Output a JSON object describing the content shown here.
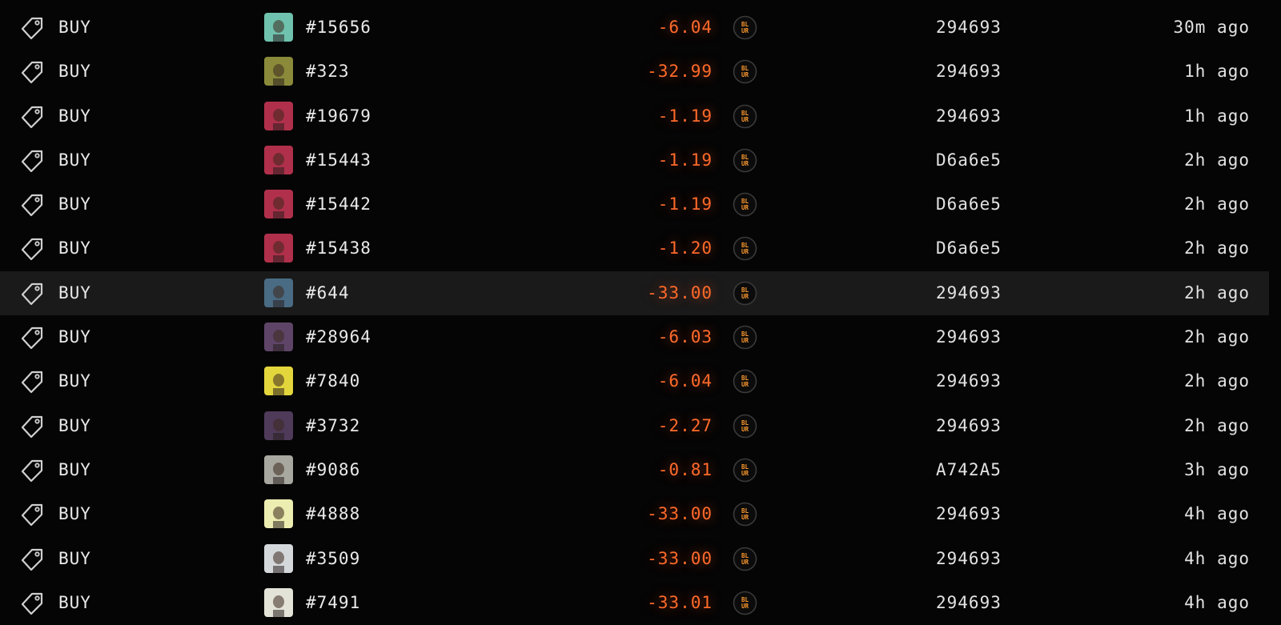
{
  "currency_icon": "blur-coin-icon",
  "action_icon": "price-tag-icon",
  "colors": {
    "background": "#050505",
    "highlight_row": "#1a1a1a",
    "price": "#ff6a2b",
    "coin_text": "#ff9a2e",
    "text": "#e8e8e8"
  },
  "rows": [
    {
      "action": "BUY",
      "token_id": "#15656",
      "price": "-6.04",
      "address": "294693",
      "time": "30m ago",
      "thumb_bg": "#6fc2ad",
      "highlighted": false
    },
    {
      "action": "BUY",
      "token_id": "#323",
      "price": "-32.99",
      "address": "294693",
      "time": "1h ago",
      "thumb_bg": "#8a8a3a",
      "highlighted": false
    },
    {
      "action": "BUY",
      "token_id": "#19679",
      "price": "-1.19",
      "address": "294693",
      "time": "1h ago",
      "thumb_bg": "#b0304b",
      "highlighted": false
    },
    {
      "action": "BUY",
      "token_id": "#15443",
      "price": "-1.19",
      "address": "D6a6e5",
      "time": "2h ago",
      "thumb_bg": "#b0304b",
      "highlighted": false
    },
    {
      "action": "BUY",
      "token_id": "#15442",
      "price": "-1.19",
      "address": "D6a6e5",
      "time": "2h ago",
      "thumb_bg": "#b0304b",
      "highlighted": false
    },
    {
      "action": "BUY",
      "token_id": "#15438",
      "price": "-1.20",
      "address": "D6a6e5",
      "time": "2h ago",
      "thumb_bg": "#b0304b",
      "highlighted": false
    },
    {
      "action": "BUY",
      "token_id": "#644",
      "price": "-33.00",
      "address": "294693",
      "time": "2h ago",
      "thumb_bg": "#4a6b84",
      "highlighted": true
    },
    {
      "action": "BUY",
      "token_id": "#28964",
      "price": "-6.03",
      "address": "294693",
      "time": "2h ago",
      "thumb_bg": "#5e4568",
      "highlighted": false
    },
    {
      "action": "BUY",
      "token_id": "#7840",
      "price": "-6.04",
      "address": "294693",
      "time": "2h ago",
      "thumb_bg": "#e3d63c",
      "highlighted": false
    },
    {
      "action": "BUY",
      "token_id": "#3732",
      "price": "-2.27",
      "address": "294693",
      "time": "2h ago",
      "thumb_bg": "#4f3a5a",
      "highlighted": false
    },
    {
      "action": "BUY",
      "token_id": "#9086",
      "price": "-0.81",
      "address": "A742A5",
      "time": "3h ago",
      "thumb_bg": "#a8a8a0",
      "highlighted": false
    },
    {
      "action": "BUY",
      "token_id": "#4888",
      "price": "-33.00",
      "address": "294693",
      "time": "4h ago",
      "thumb_bg": "#ecedb0",
      "highlighted": false
    },
    {
      "action": "BUY",
      "token_id": "#3509",
      "price": "-33.00",
      "address": "294693",
      "time": "4h ago",
      "thumb_bg": "#d4d8da",
      "highlighted": false
    },
    {
      "action": "BUY",
      "token_id": "#7491",
      "price": "-33.01",
      "address": "294693",
      "time": "4h ago",
      "thumb_bg": "#e3e3d8",
      "highlighted": false
    }
  ]
}
